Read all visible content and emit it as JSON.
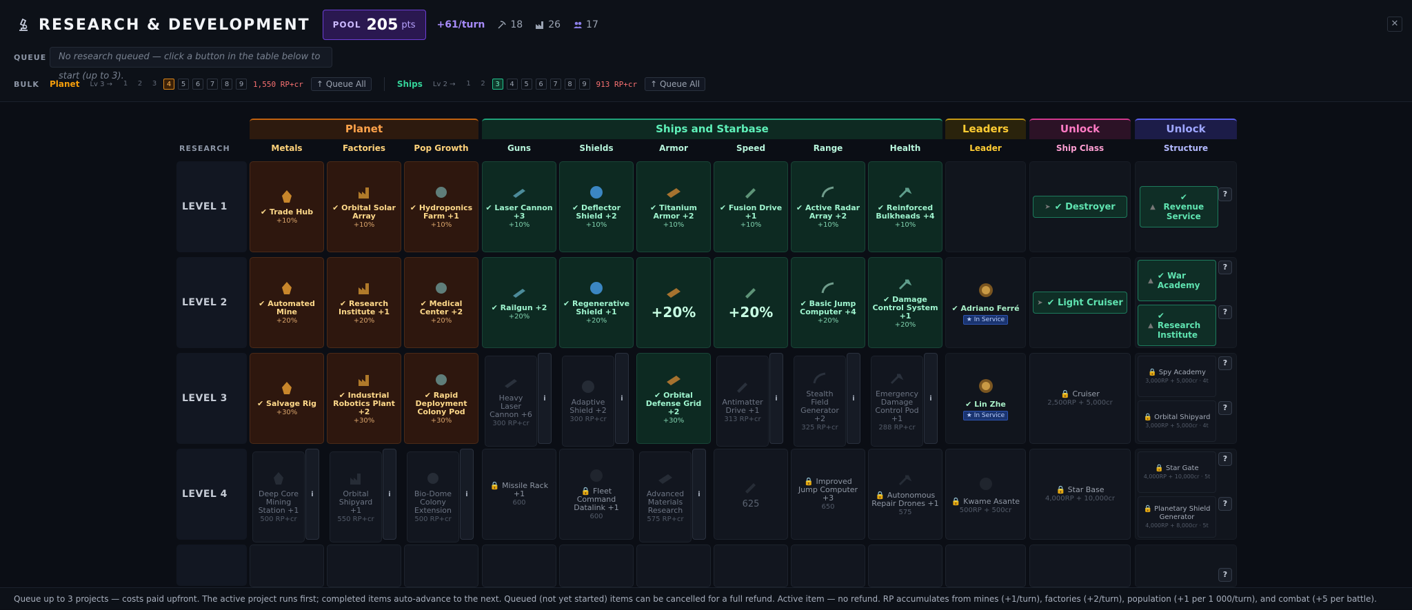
{
  "header": {
    "title": "RESEARCH & DEVELOPMENT",
    "pool_label": "POOL",
    "pool_value": "205",
    "pool_unit": "pts",
    "rate": "+61/turn",
    "stats": [
      {
        "icon": "pickaxe-icon",
        "value": "18"
      },
      {
        "icon": "factory-icon",
        "value": "26"
      },
      {
        "icon": "population-icon",
        "value": "17"
      }
    ],
    "close_label": "✕"
  },
  "queue": {
    "label": "QUEUE",
    "placeholder": "No research queued — click a button in the table below to start (up to 3)."
  },
  "bulk": {
    "label": "BULK",
    "planet": {
      "name": "Planet",
      "lv": "Lv 3 →",
      "levels": [
        "1",
        "2",
        "3",
        "4",
        "5",
        "6",
        "7",
        "8",
        "9"
      ],
      "selected": "4",
      "cost": "1,550 RP+cr",
      "queue_all": "↑ Queue All"
    },
    "ships": {
      "name": "Ships",
      "lv": "Lv 2 →",
      "levels": [
        "1",
        "2",
        "3",
        "4",
        "5",
        "6",
        "7",
        "8",
        "9"
      ],
      "selected": "3",
      "cost": "913 RP+cr",
      "queue_all": "↑ Queue All"
    }
  },
  "colors": {
    "planet": "#f59e0b",
    "ships": "#34d399",
    "leaders": "#fbbf24",
    "unlock_ship": "#f472b6",
    "unlock_struct": "#818cf8"
  },
  "groups": {
    "planet": "Planet",
    "ships": "Ships and Starbase",
    "leaders": "Leaders",
    "unlock1": "Unlock",
    "unlock2": "Unlock"
  },
  "columns": {
    "research": "RESEARCH",
    "metals": "Metals",
    "factories": "Factories",
    "pop": "Pop Growth",
    "guns": "Guns",
    "shields": "Shields",
    "armor": "Armor",
    "speed": "Speed",
    "range": "Range",
    "health": "Health",
    "leader": "Leader",
    "ship_class": "Ship Class",
    "structure": "Structure"
  },
  "levels": [
    "LEVEL 1",
    "LEVEL 2",
    "LEVEL 3",
    "LEVEL 4"
  ],
  "cells": {
    "l1": {
      "metals": {
        "name": "✔ Trade Hub",
        "sub": "+10%"
      },
      "factories": {
        "name": "✔ Orbital Solar Array",
        "sub": "+10%"
      },
      "pop": {
        "name": "✔ Hydroponics Farm +1",
        "sub": "+10%"
      },
      "guns": {
        "name": "✔ Laser Cannon +3",
        "sub": "+10%"
      },
      "shields": {
        "name": "✔ Deflector Shield +2",
        "sub": "+10%"
      },
      "armor": {
        "name": "✔ Titanium Armor +2",
        "sub": "+10%"
      },
      "speed": {
        "name": "✔ Fusion Drive +1",
        "sub": "+10%"
      },
      "range": {
        "name": "✔ Active Radar Array +2",
        "sub": "+10%"
      },
      "health": {
        "name": "✔ Reinforced Bulkheads +4",
        "sub": "+10%"
      },
      "ship_class": "✔ Destroyer",
      "structure": "✔ Revenue Service"
    },
    "l2": {
      "metals": {
        "name": "✔ Automated Mine",
        "sub": "+20%"
      },
      "factories": {
        "name": "✔ Research Institute +1",
        "sub": "+20%"
      },
      "pop": {
        "name": "✔ Medical Center +2",
        "sub": "+20%"
      },
      "guns": {
        "name": "✔ Railgun +2",
        "sub": "+20%"
      },
      "shields": {
        "name": "✔ Regenerative Shield +1",
        "sub": "+20%"
      },
      "armor": {
        "big": "+20%"
      },
      "speed": {
        "big": "+20%"
      },
      "range": {
        "name": "✔ Basic Jump Computer +4",
        "sub": "+20%"
      },
      "health": {
        "name": "✔ Damage Control System +1",
        "sub": "+20%"
      },
      "leader": {
        "name": "✔ Adriano Ferré",
        "badge": "★ In Service"
      },
      "ship_class": "✔ Light Cruiser",
      "structure_a": "✔ War Academy",
      "structure_b": "✔ Research Institute"
    },
    "l3": {
      "metals": {
        "name": "✔ Salvage Rig",
        "sub": "+30%"
      },
      "factories": {
        "name": "✔ Industrial Robotics Plant +2",
        "sub": "+30%"
      },
      "pop": {
        "name": "✔ Rapid Deployment Colony Pod",
        "sub": "+30%"
      },
      "guns": {
        "name": "Heavy Laser Cannon +6",
        "sub": "300 RP+cr"
      },
      "shields": {
        "name": "Adaptive Shield +2",
        "sub": "300 RP+cr"
      },
      "armor": {
        "name": "✔ Orbital Defense Grid +2",
        "sub": "+30%"
      },
      "speed": {
        "name": "Antimatter Drive +1",
        "sub": "313 RP+cr"
      },
      "range": {
        "name": "Stealth Field Generator +2",
        "sub": "325 RP+cr"
      },
      "health": {
        "name": "Emergency Damage Control Pod +1",
        "sub": "288 RP+cr"
      },
      "leader": {
        "name": "✔ Lin Zhe",
        "badge": "★ In Service"
      },
      "ship_class": {
        "name": "🔒 Cruiser",
        "sub": "2,500RP + 5,000cr"
      },
      "structure_a": {
        "name": "🔒 Spy Academy",
        "sub": "3,000RP + 5,000cr · 4t"
      },
      "structure_b": {
        "name": "🔒 Orbital Shipyard",
        "sub": "3,000RP + 5,000cr · 4t"
      }
    },
    "l4": {
      "metals": {
        "name": "Deep Core Mining Station +1",
        "sub": "500 RP+cr"
      },
      "factories": {
        "name": "Orbital Shipyard +1",
        "sub": "550 RP+cr"
      },
      "pop": {
        "name": "Bio-Dome Colony Extension",
        "sub": "500 RP+cr"
      },
      "guns": {
        "name": "🔒 Missile Rack +1",
        "sub": "600"
      },
      "shields": {
        "name": "🔒 Fleet Command Datalink +1",
        "sub": "600"
      },
      "armor": {
        "name": "Advanced Materials Research",
        "sub": "575 RP+cr"
      },
      "speed": {
        "big": "625"
      },
      "range": {
        "name": "🔒 Improved Jump Computer +3",
        "sub": "650"
      },
      "health": {
        "name": "🔒 Autonomous Repair Drones +1",
        "sub": "575"
      },
      "leader": {
        "name": "🔒 Kwame Asante",
        "sub": "500RP + 500cr"
      },
      "ship_class": {
        "name": "🔒 Star Base",
        "sub": "4,000RP + 10,000cr"
      },
      "structure_a": {
        "name": "🔒 Star Gate",
        "sub": "4,000RP + 10,000cr · 5t"
      },
      "structure_b": {
        "name": "🔒 Planetary Shield Generator",
        "sub": "4,000RP + 8,000cr · 5t"
      }
    }
  },
  "info_label": "i",
  "help_label": "?",
  "footer": "Queue up to 3 projects — costs paid upfront. The active project runs first; completed items auto-advance to the next. Queued (not yet started) items can be cancelled for a full refund. Active item — no refund. RP accumulates from mines (+1/turn), factories (+2/turn), population (+1 per 1 000/turn), and combat (+5 per battle)."
}
